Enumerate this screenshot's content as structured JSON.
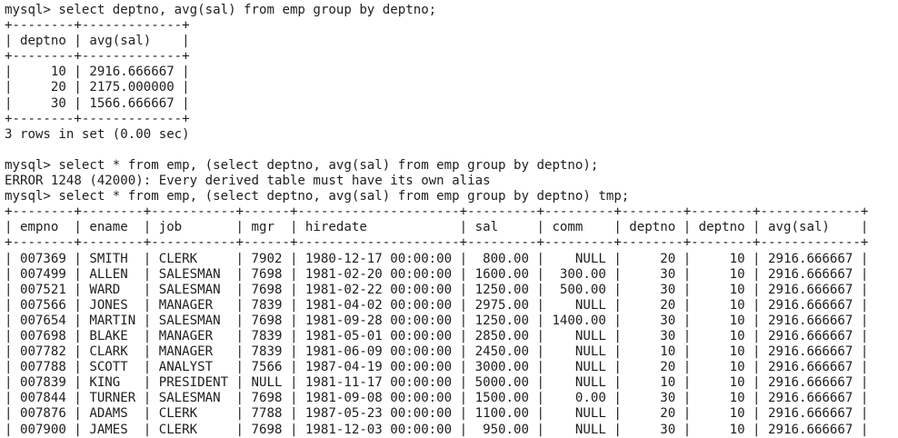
{
  "terminal": {
    "lines": [
      "mysql> select deptno, avg(sal) from emp group by deptno;",
      "+--------+-------------+",
      "| deptno | avg(sal)    |",
      "+--------+-------------+",
      "|     10 | 2916.666667 |",
      "|     20 | 2175.000000 |",
      "|     30 | 1566.666667 |",
      "+--------+-------------+",
      "3 rows in set (0.00 sec)",
      "",
      "mysql> select * from emp, (select deptno, avg(sal) from emp group by deptno);",
      "ERROR 1248 (42000): Every derived table must have its own alias",
      "mysql> select * from emp, (select deptno, avg(sal) from emp group by deptno) tmp;",
      "+--------+--------+-----------+------+---------------------+---------+---------+--------+--------+-------------+",
      "| empno  | ename  | job       | mgr  | hiredate            | sal     | comm    | deptno | deptno | avg(sal)    |",
      "+--------+--------+-----------+------+---------------------+---------+---------+--------+--------+-------------+",
      "| 007369 | SMITH  | CLERK     | 7902 | 1980-12-17 00:00:00 |  800.00 |    NULL |     20 |     10 | 2916.666667 |",
      "| 007499 | ALLEN  | SALESMAN  | 7698 | 1981-02-20 00:00:00 | 1600.00 |  300.00 |     30 |     10 | 2916.666667 |",
      "| 007521 | WARD   | SALESMAN  | 7698 | 1981-02-22 00:00:00 | 1250.00 |  500.00 |     30 |     10 | 2916.666667 |",
      "| 007566 | JONES  | MANAGER   | 7839 | 1981-04-02 00:00:00 | 2975.00 |    NULL |     20 |     10 | 2916.666667 |",
      "| 007654 | MARTIN | SALESMAN  | 7698 | 1981-09-28 00:00:00 | 1250.00 | 1400.00 |     30 |     10 | 2916.666667 |",
      "| 007698 | BLAKE  | MANAGER   | 7839 | 1981-05-01 00:00:00 | 2850.00 |    NULL |     30 |     10 | 2916.666667 |",
      "| 007782 | CLARK  | MANAGER   | 7839 | 1981-06-09 00:00:00 | 2450.00 |    NULL |     10 |     10 | 2916.666667 |",
      "| 007788 | SCOTT  | ANALYST   | 7566 | 1987-04-19 00:00:00 | 3000.00 |    NULL |     20 |     10 | 2916.666667 |",
      "| 007839 | KING   | PRESIDENT | NULL | 1981-11-17 00:00:00 | 5000.00 |    NULL |     10 |     10 | 2916.666667 |",
      "| 007844 | TURNER | SALESMAN  | 7698 | 1981-09-08 00:00:00 | 1500.00 |    0.00 |     30 |     10 | 2916.666667 |",
      "| 007876 | ADAMS  | CLERK     | 7788 | 1987-05-23 00:00:00 | 1100.00 |    NULL |     20 |     10 | 2916.666667 |",
      "| 007900 | JAMES  | CLERK     | 7698 | 1981-12-03 00:00:00 |  950.00 |    NULL |     30 |     10 | 2916.666667 |"
    ]
  }
}
